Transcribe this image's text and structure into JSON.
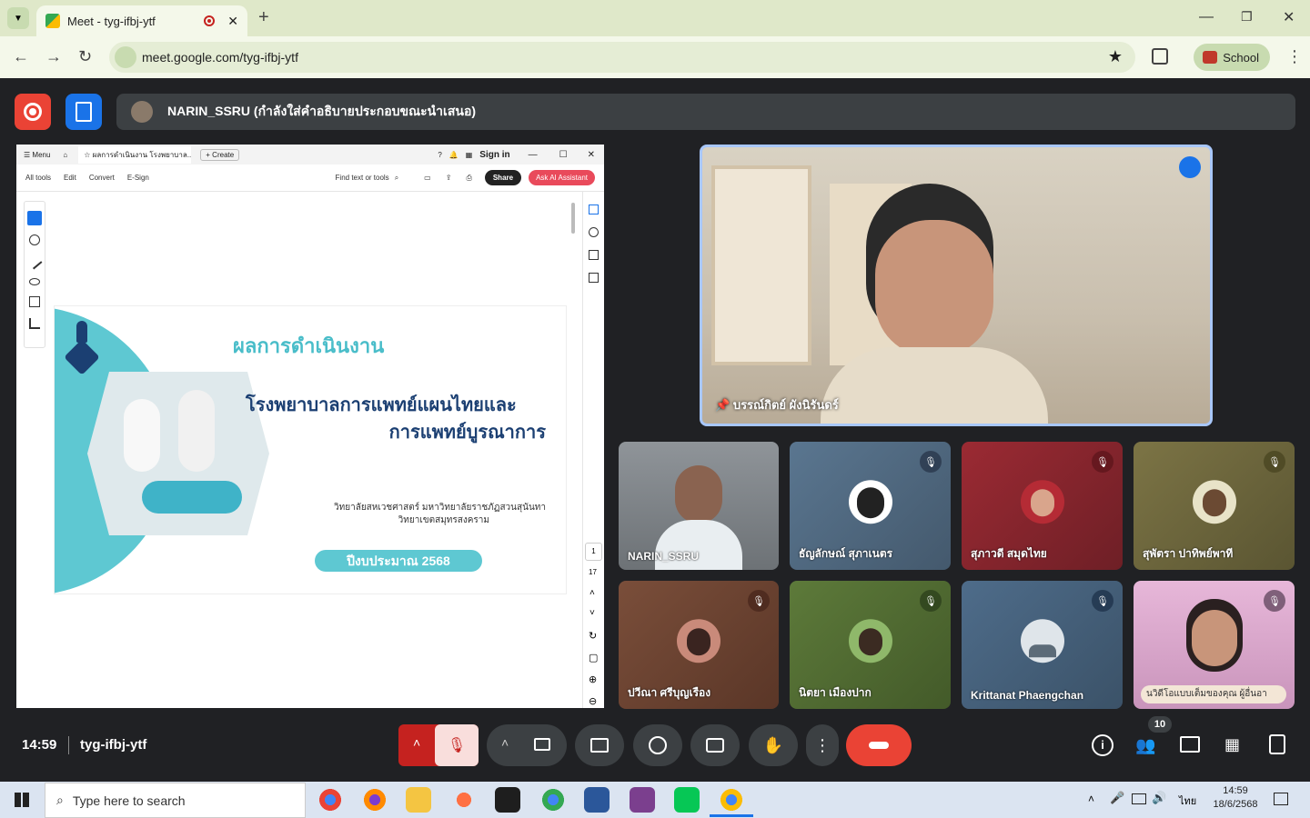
{
  "browser": {
    "tab_title": "Meet - tyg-ifbj-ytf",
    "url": "meet.google.com/tyg-ifbj-ytf",
    "profile": "School"
  },
  "meet": {
    "presenter_text": "NARIN_SSRU (กำลังใส่คำอธิบายประกอบขณะนำเสนอ)",
    "time": "14:59",
    "meeting_code": "tyg-ifbj-ytf",
    "participant_count": "10"
  },
  "viewer": {
    "menu": "Menu",
    "tab_label": "ผลการดำเนินงาน โรงพยาบาล...",
    "create": "Create",
    "sign_in": "Sign in",
    "tools": [
      "All tools",
      "Edit",
      "Convert",
      "E-Sign"
    ],
    "find": "Find text or tools",
    "share": "Share",
    "ai": "Ask AI Assistant",
    "page_current": "1",
    "page_total": "17"
  },
  "slide": {
    "title": "ผลการดำเนินงาน",
    "hospital_line1": "โรงพยาบาลการแพทย์แผนไทยและ",
    "hospital_line2": "การแพทย์บูรณาการ",
    "college_line1": "วิทยาลัยสหเวชศาสตร์ มหาวิทยาลัยราชภัฏสวนสุนันทา",
    "college_line2": "วิทยาเขตสมุทรสงคราม",
    "year": "ปีงบประมาณ 2568"
  },
  "participants": {
    "pinned": "บรรณ์กิตย์ ผังนิรันดร์",
    "tiles": [
      {
        "name": "NARIN_SSRU"
      },
      {
        "name": "ธัญลักษณ์ สุภาเนตร"
      },
      {
        "name": "สุภาวดี สมุดไทย"
      },
      {
        "name": "สุพัตรา ปาทิพย์พาที"
      },
      {
        "name": "ปวีณา ศรีบุญเรือง"
      },
      {
        "name": "นิตยา เมืองปาก"
      },
      {
        "name": "Krittanat Phaengchan"
      },
      {
        "name": "นวิดีโอแบบเต็มของคุณ ผู้อื่นอา"
      }
    ]
  },
  "taskbar": {
    "search_placeholder": "Type here to search",
    "clock_time": "14:59",
    "clock_date": "18/6/2568",
    "lang": "ไทย"
  }
}
